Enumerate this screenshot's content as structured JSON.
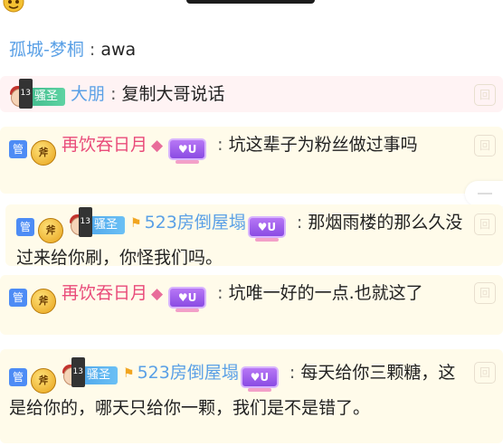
{
  "messages": {
    "m1": {
      "nick": "孤城-梦桐",
      "colon": " : ",
      "text": "awa"
    },
    "m2": {
      "fan_badge": "骚圣",
      "nick": "大朋",
      "colon": " : ",
      "text": "复制大哥说话"
    },
    "m3": {
      "admin": "管",
      "level": "斧",
      "nick": "再饮吞日月",
      "vip": "♥U",
      "colon": " : ",
      "text": "坑这辈子为粉丝做过事吗"
    },
    "m4": {
      "admin": "管",
      "level": "斧",
      "fan_badge": "骚圣",
      "nick": "523房倒屋塌",
      "vip": "♥U",
      "colon": " : ",
      "text": "那烟雨楼的那么久没过来给你刷，你怪我们吗。"
    },
    "m5": {
      "admin": "管",
      "level": "斧",
      "nick": "再饮吞日月",
      "vip": "♥U",
      "colon": " : ",
      "text": "坑唯一好的一点.也就这了"
    },
    "m6": {
      "admin": "管",
      "level": "斧",
      "fan_badge": "骚圣",
      "nick": "523房倒屋塌",
      "vip": "♥U",
      "colon": " : ",
      "text": "每天给你三颗糖，这是给你的，哪天只给你一颗，我们是不是错了。"
    }
  },
  "side_icon_label": "回",
  "icons": {
    "top": "emoji-face-icon",
    "gem": "diamond-icon",
    "flag": "fan-flag-icon"
  },
  "colors": {
    "nick_blue": "#5aa0e6",
    "nick_pink": "#e94b7a",
    "admin_badge": "#4d8cf5",
    "vip": "#8a4be3"
  }
}
